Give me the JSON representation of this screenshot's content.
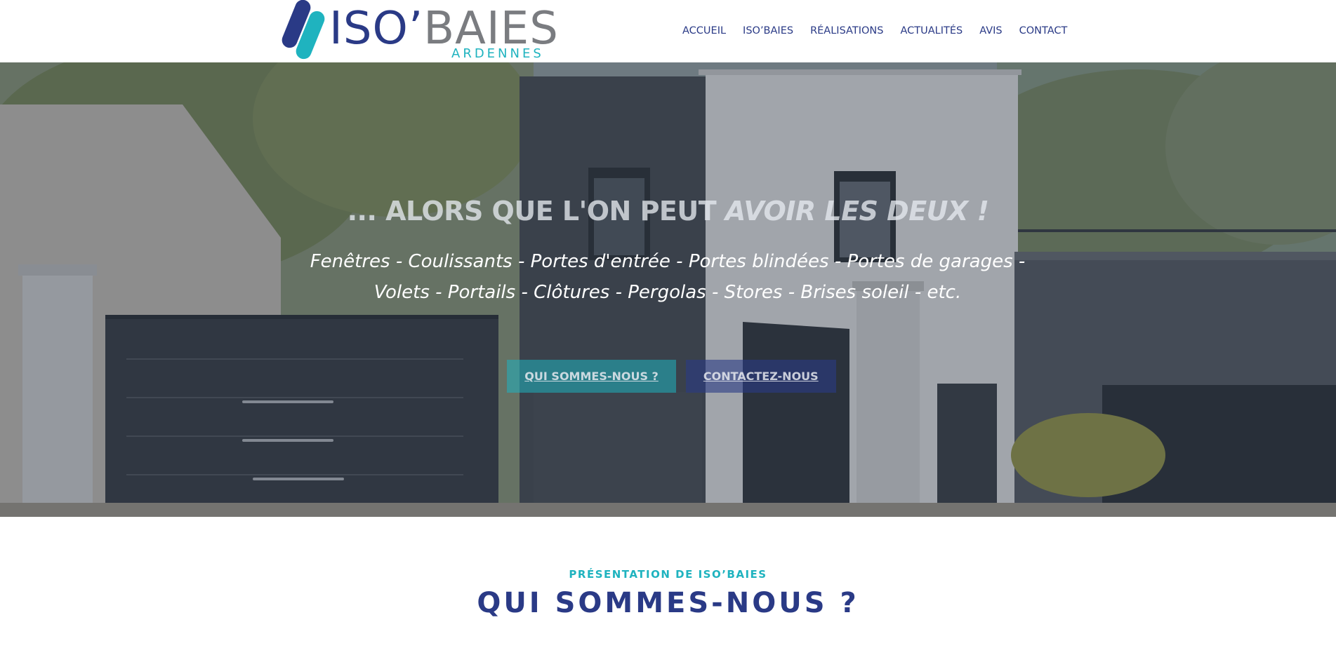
{
  "brand": {
    "iso": "ISO’",
    "baies": "BAIES",
    "sub": "ARDENNES",
    "colors": {
      "navy": "#2a3a86",
      "teal": "#1fb3bf",
      "grey": "#7a7c80"
    }
  },
  "nav": {
    "items": [
      "ACCUEIL",
      "ISO’BAIES",
      "RÉALISATIONS",
      "ACTUALITÉS",
      "AVIS",
      "CONTACT"
    ]
  },
  "hero": {
    "title_part1": "... ALORS QUE L'ON PEUT ",
    "title_part2": "AVOIR LES DEUX !",
    "subtitle": "Fenêtres - Coulissants - Portes d'entrée - Portes blindées - Portes de garages - Volets - Portails - Clôtures - Pergolas - Stores - Brises soleil - etc.",
    "button_about": "QUI SOMMES-NOUS ?",
    "button_contact": "CONTACTEZ-NOUS"
  },
  "presentation": {
    "eyebrow": "PRÉSENTATION DE ISO’BAIES",
    "title": "QUI SOMMES-NOUS ?"
  }
}
